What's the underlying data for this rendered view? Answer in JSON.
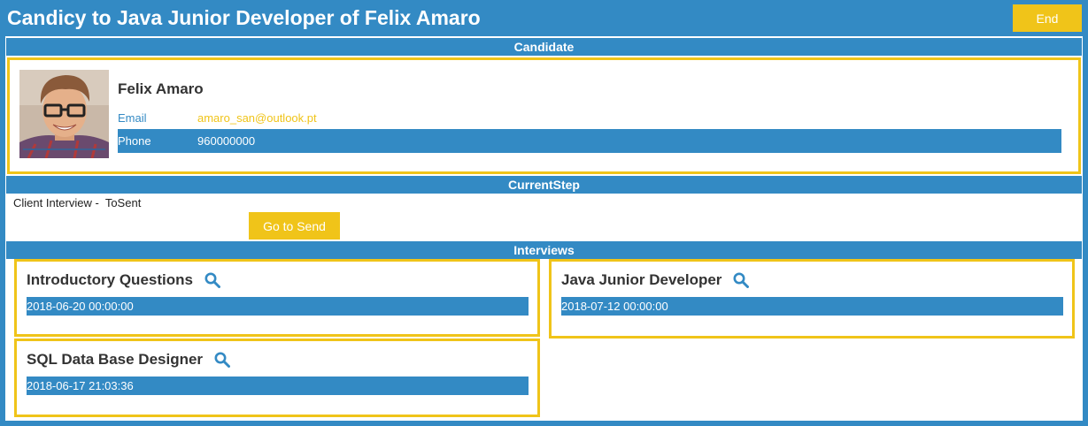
{
  "header": {
    "title": "Candicy to Java Junior Developer of Felix Amaro",
    "end_label": "End"
  },
  "sections": {
    "candidate": "Candidate",
    "current_step": "CurrentStep",
    "interviews": "Interviews"
  },
  "candidate": {
    "name": "Felix Amaro",
    "email_label": "Email",
    "email": "amaro_san@outlook.pt",
    "phone_label": "Phone",
    "phone": "960000000"
  },
  "current_step": {
    "step": "Client Interview",
    "separator": " - ",
    "status": "ToSent",
    "action_label": "Go to Send"
  },
  "interviews": [
    {
      "title": "Introductory Questions",
      "date": "2018-06-20 00:00:00"
    },
    {
      "title": "Java Junior Developer",
      "date": "2018-07-12 00:00:00"
    },
    {
      "title": "SQL Data Base Designer",
      "date": "2018-06-17 21:03:36"
    }
  ],
  "colors": {
    "primary": "#338ac4",
    "accent": "#f0c419",
    "background": "#ffffff"
  },
  "icons": [
    "search-icon",
    "avatar"
  ]
}
